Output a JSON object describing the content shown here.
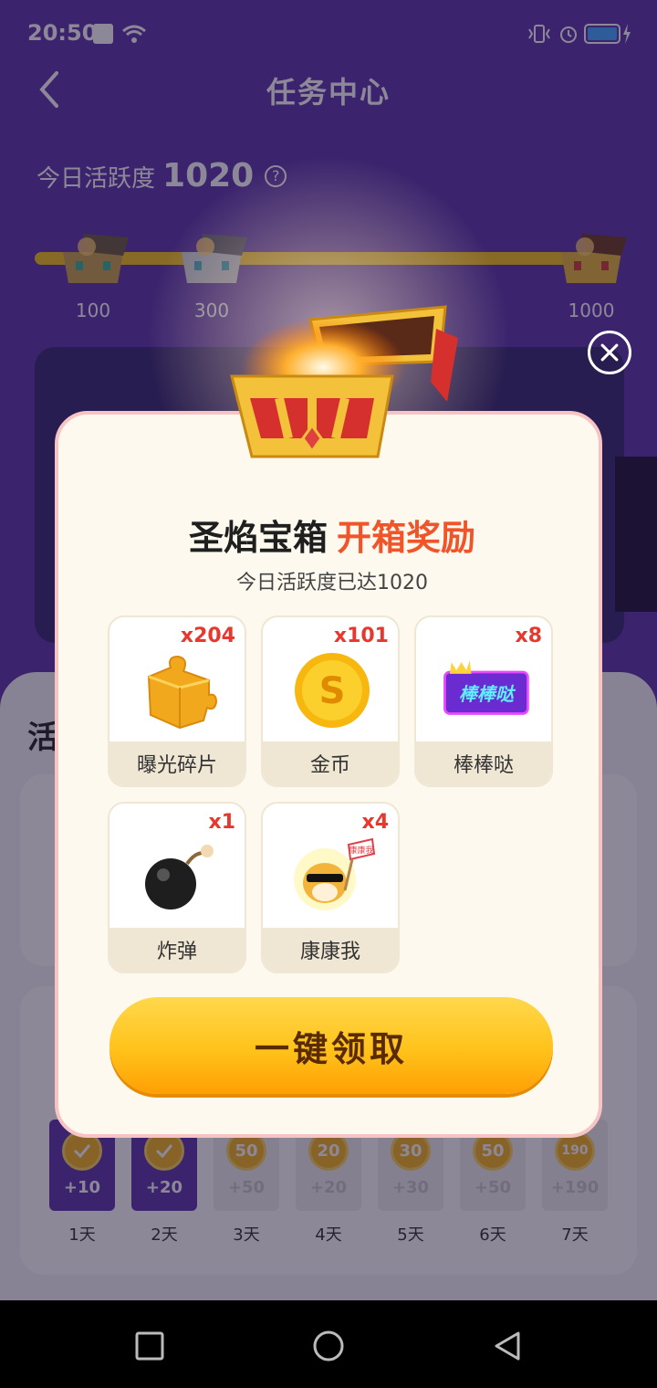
{
  "status_bar": {
    "time": "20:50"
  },
  "header": {
    "title": "任务中心"
  },
  "activity": {
    "label": "今日活跃度",
    "value": "1020",
    "help": "?"
  },
  "milestones": [
    {
      "label": "100"
    },
    {
      "label": "300"
    },
    {
      "label": "1000"
    }
  ],
  "lower_section": {
    "title": "活"
  },
  "checkin": {
    "days": [
      {
        "coin": "",
        "reward": "+10",
        "label": "1天",
        "done": true
      },
      {
        "coin": "",
        "reward": "+20",
        "label": "2天",
        "done": true
      },
      {
        "coin": "50",
        "reward": "+50",
        "label": "3天",
        "done": false
      },
      {
        "coin": "20",
        "reward": "+20",
        "label": "4天",
        "done": false
      },
      {
        "coin": "30",
        "reward": "+30",
        "label": "5天",
        "done": false
      },
      {
        "coin": "50",
        "reward": "+50",
        "label": "6天",
        "done": false
      },
      {
        "coin": "190",
        "reward": "+190",
        "label": "7天",
        "done": false
      }
    ]
  },
  "modal": {
    "title": "圣焰宝箱",
    "title_accent": "开箱奖励",
    "subtitle": "今日活跃度已达1020",
    "rewards": [
      {
        "name": "曝光碎片",
        "count": "x204",
        "icon": "puzzle-piece-icon"
      },
      {
        "name": "金币",
        "count": "x101",
        "icon": "gold-coin-icon"
      },
      {
        "name": "棒棒哒",
        "count": "x8",
        "icon": "bangbangda-badge-icon",
        "badge_text": "棒棒哒"
      },
      {
        "name": "炸弹",
        "count": "x1",
        "icon": "bomb-icon"
      },
      {
        "name": "康康我",
        "count": "x4",
        "icon": "doge-sign-icon",
        "sign_text": "康康我"
      }
    ],
    "claim_label": "一键领取"
  },
  "colors": {
    "page_bg": "#5b36a8",
    "accent_red": "#f05428",
    "count_red": "#e8372c",
    "button_yellow": "#ffc21a",
    "progress_yellow": "#f2c21a"
  }
}
